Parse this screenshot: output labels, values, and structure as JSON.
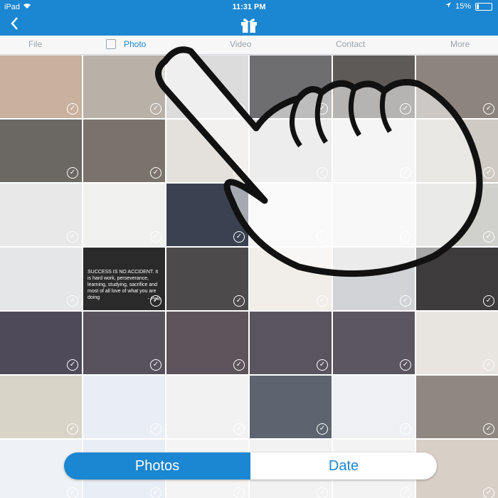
{
  "status_bar": {
    "carrier": "iPad",
    "time": "11:31 PM",
    "battery": "15%",
    "battery_level": 0.15
  },
  "nav": {
    "back_icon": "chevron-left-icon",
    "center_icon": "gift-icon"
  },
  "tabs": [
    {
      "label": "File",
      "active": false
    },
    {
      "label": "Photo",
      "active": true
    },
    {
      "label": "Video",
      "active": false
    },
    {
      "label": "Contact",
      "active": false
    },
    {
      "label": "More",
      "active": false
    }
  ],
  "grid": {
    "columns": 6,
    "selected_mark": "✓",
    "quote_text": "SUCCESS IS NO ACCIDENT. It is hard work, perseverance, learning, studying, sacrifice and most of all love of what you are doing",
    "quote_author": "- Pele",
    "cells": [
      "#c9b19d",
      "#b9b1a8",
      "#dcdcdc",
      "#6e6e70",
      "#5e5a57",
      "#8c857f",
      "#6b6762",
      "#7a736b",
      "#e4e1dc",
      "#d8d8d8",
      "#e9e9e9",
      "#cfcac3",
      "#e8e8e8",
      "#f0f0ee",
      "#3a4150",
      "#f1f1f1",
      "#f0f0f0",
      "#d0d0cc",
      "#e5e6e8",
      "#2a2a2a",
      "#4d4a4c",
      "#f1ede8",
      "#d2d3d6",
      "#3d3b3c",
      "#4f4a5a",
      "#57525c",
      "#5c545a",
      "#5a545e",
      "#5b5660",
      "#e8e4e0",
      "#d9d4c8",
      "#e9eef6",
      "#f2f2f2",
      "#5d6470",
      "#eef0f3",
      "#8e8880",
      "#eef1f5",
      "#e9edf5",
      "#f4f4f4",
      "#f2f2f2",
      "#f3f3f3",
      "#d8cfc6"
    ]
  },
  "segment": {
    "left_label": "Photos",
    "right_label": "Date",
    "selected": "left"
  },
  "colors": {
    "accent": "#1b86d1",
    "tab_inactive": "#9aa3ab"
  }
}
